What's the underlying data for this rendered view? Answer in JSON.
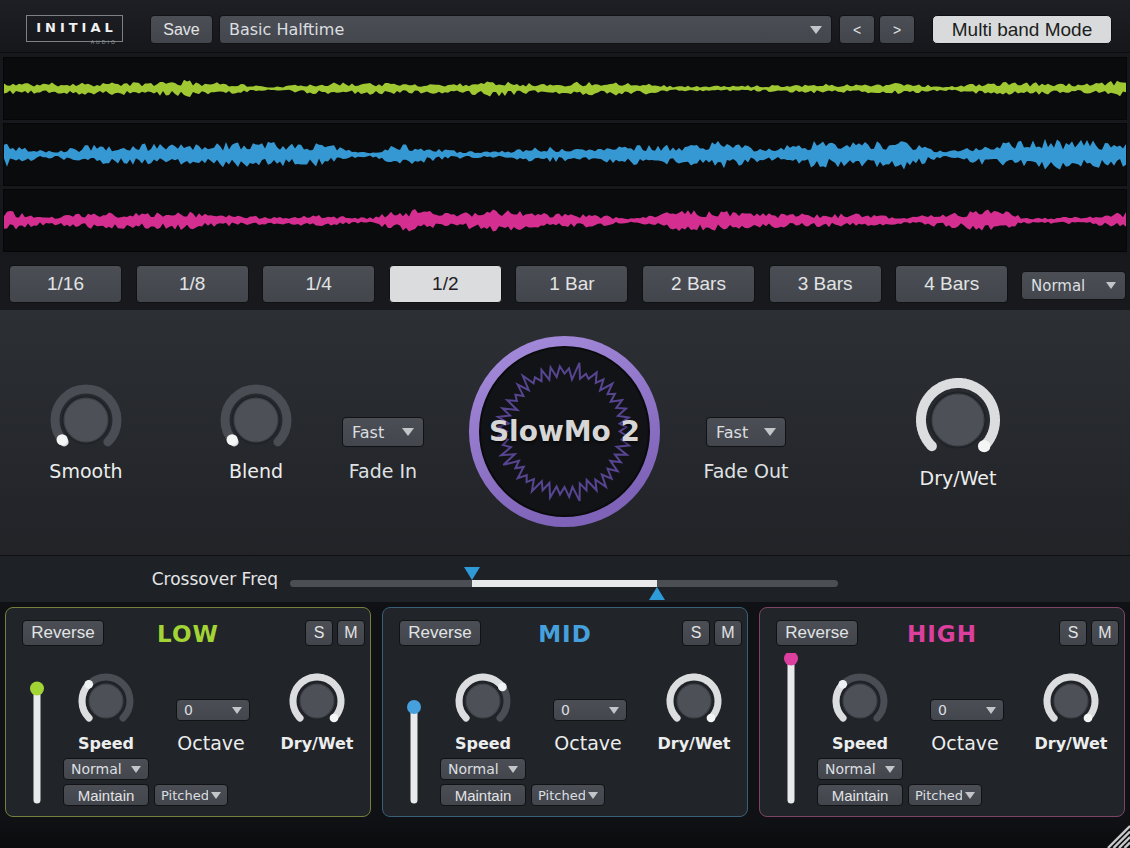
{
  "topbar": {
    "logo_text": "INITIAL",
    "logo_sub": "AUDIO",
    "save_label": "Save",
    "preset_value": "Basic Halftime",
    "prev_label": "<",
    "next_label": ">",
    "mode_button_label": "Multi band Mode"
  },
  "waveforms": {
    "low": {
      "color": "#a0c832",
      "seed": 11,
      "amp": 6.0
    },
    "mid": {
      "color": "#3598d2",
      "seed": 47,
      "amp": 11.0
    },
    "high": {
      "color": "#d42e90",
      "seed": 83,
      "amp": 8.0
    }
  },
  "timerow": {
    "buttons": [
      "1/16",
      "1/8",
      "1/4",
      "1/2",
      "1 Bar",
      "2 Bars",
      "3 Bars",
      "4 Bars"
    ],
    "selected_index": 3,
    "quantize_value": "Normal"
  },
  "main": {
    "logo_text": "SlowMo 2",
    "smooth": {
      "label": "Smooth",
      "value": 0.0
    },
    "blend": {
      "label": "Blend",
      "value": 0.0
    },
    "fade_in": {
      "label": "Fade In",
      "value": "Fast"
    },
    "fade_out": {
      "label": "Fade Out",
      "value": "Fast"
    },
    "dry_wet": {
      "label": "Dry/Wet",
      "value": 1.0
    }
  },
  "crossover": {
    "label": "Crossover Freq",
    "handle_low": 0.332,
    "handle_high": 0.67,
    "accent": "#2e9ad8"
  },
  "bands": [
    {
      "name": "LOW",
      "color": "#a2d435",
      "border": "#73813c",
      "level": 0.22,
      "reverse_label": "Reverse",
      "solo_label": "S",
      "mute_label": "M",
      "speed": 0.33,
      "speed_label": "Speed",
      "octave_value": "0",
      "octave_label": "Octave",
      "dry_wet": 1.0,
      "dry_wet_label": "Dry/Wet",
      "mode_value": "Normal",
      "maintain_label": "Maintain",
      "pitch_value": "Pitched"
    },
    {
      "name": "MID",
      "color": "#45a0dd",
      "border": "#3a5f78",
      "level": 0.35,
      "reverse_label": "Reverse",
      "solo_label": "S",
      "mute_label": "M",
      "speed": 0.7,
      "speed_label": "Speed",
      "octave_value": "0",
      "octave_label": "Octave",
      "dry_wet": 1.0,
      "dry_wet_label": "Dry/Wet",
      "mode_value": "Normal",
      "maintain_label": "Maintain",
      "pitch_value": "Pitched"
    },
    {
      "name": "HIGH",
      "color": "#dd3f9f",
      "border": "#7e4466",
      "level": 0.01,
      "reverse_label": "Reverse",
      "solo_label": "S",
      "mute_label": "M",
      "speed": 0.33,
      "speed_label": "Speed",
      "octave_value": "0",
      "octave_label": "Octave",
      "dry_wet": 1.0,
      "dry_wet_label": "Dry/Wet",
      "mode_value": "Normal",
      "maintain_label": "Maintain",
      "pitch_value": "Pitched"
    }
  ]
}
